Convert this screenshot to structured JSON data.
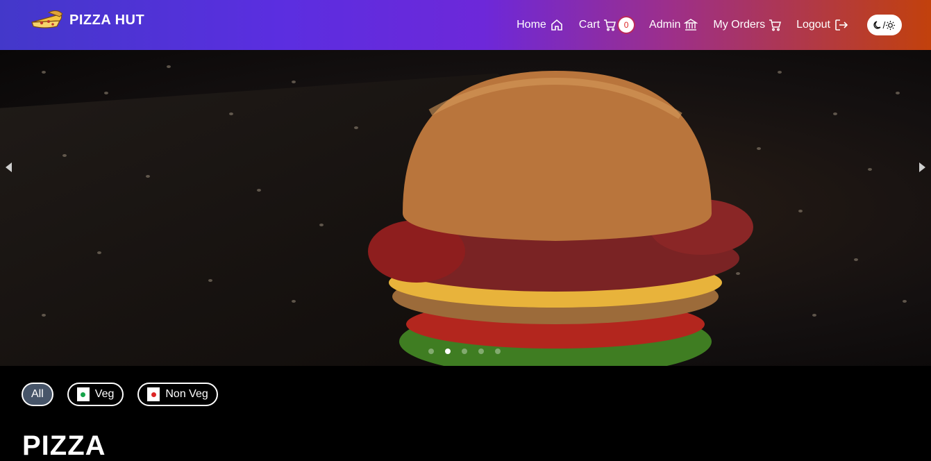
{
  "brand": {
    "name": "PIZZA HUT",
    "logo_icon": "pizza-slice-icon"
  },
  "nav": {
    "home": "Home",
    "cart": "Cart",
    "cart_count": "0",
    "admin": "Admin",
    "orders": "My Orders",
    "logout": "Logout",
    "theme_separator": "/"
  },
  "carousel": {
    "slide_count": 5,
    "active_slide": 2,
    "image_subject": "burger"
  },
  "filters": [
    {
      "label": "All",
      "active": true
    },
    {
      "label": "Veg",
      "indicator_color": "#16a34a"
    },
    {
      "label": "Non Veg",
      "indicator_color": "#dc2626"
    }
  ],
  "section": {
    "title": "PIZZA"
  },
  "colors": {
    "nav_gradient_start": "#4338ca",
    "nav_gradient_mid": "#6d28d9",
    "nav_gradient_end": "#c2410c",
    "badge": "#dc2626"
  }
}
